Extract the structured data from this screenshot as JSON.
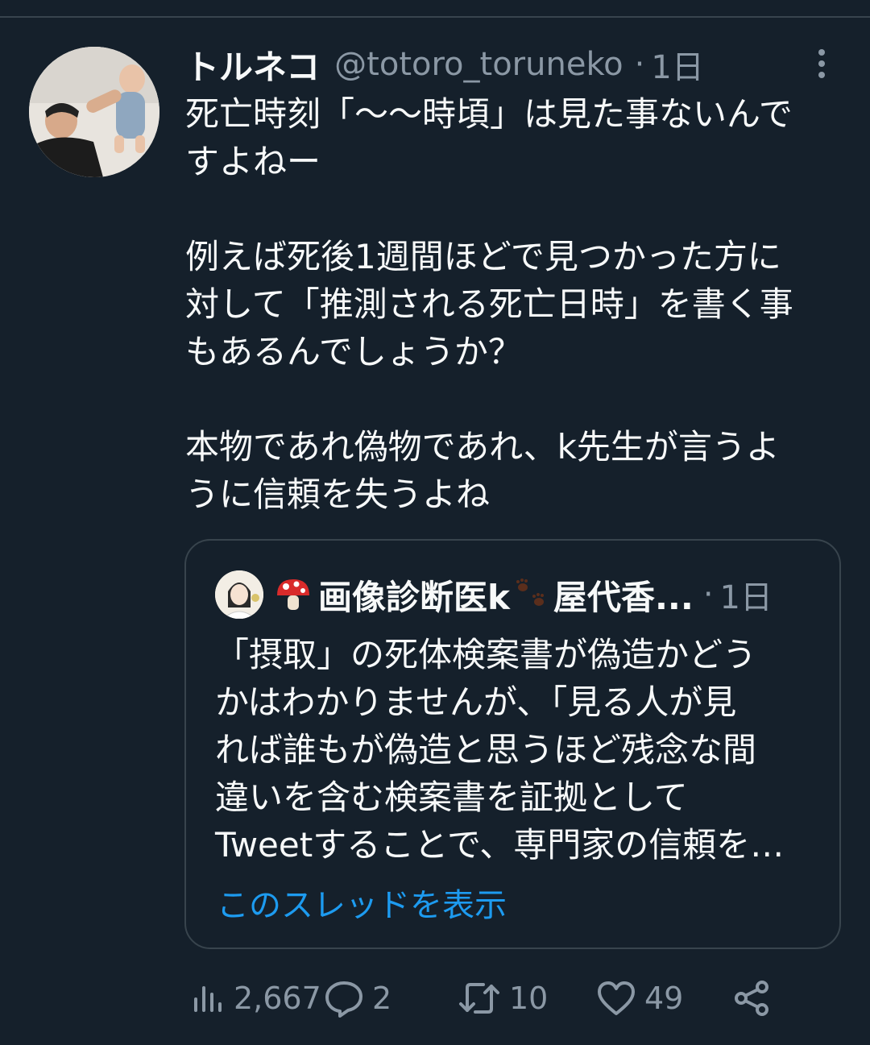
{
  "tweet": {
    "display_name": "トルネコ",
    "handle": "@totoro_toruneko",
    "separator": "·",
    "time": "1日",
    "text": "死亡時刻「〜〜時頃」は見た事ないんで\nすよねー\n\n例えば死後1週間ほどで見つかった方に\n対して「推測される死亡日時」を書く事\nもあるんでしょうか？\n\n本物であれ偽物であれ、k先生が言うよ\nうに信頼を失うよね"
  },
  "quote": {
    "display_name": "画像診断医k",
    "name_suffix": "屋代香...",
    "separator": "·",
    "time": "1日",
    "text": "「摂取」の死体検案書が偽造かどう\nかはわかりませんが、「見る人が見\nれば誰もが偽造と思うほど残念な間\n違いを含む検案書を証拠として\nTweetすることで、専門家の信頼を…",
    "show_thread": "このスレッドを表示"
  },
  "actions": {
    "views": "2,667",
    "replies": "2",
    "retweets": "10",
    "likes": "49"
  },
  "colors": {
    "background": "#15202b",
    "text": "#f7f9f9",
    "muted": "#8b98a5",
    "border": "#38444d",
    "link": "#1d9bf0"
  },
  "icons": [
    "more-vertical-icon",
    "mushroom-emoji-icon",
    "paw-prints-icon",
    "views-icon",
    "reply-icon",
    "retweet-icon",
    "like-icon",
    "share-icon"
  ]
}
